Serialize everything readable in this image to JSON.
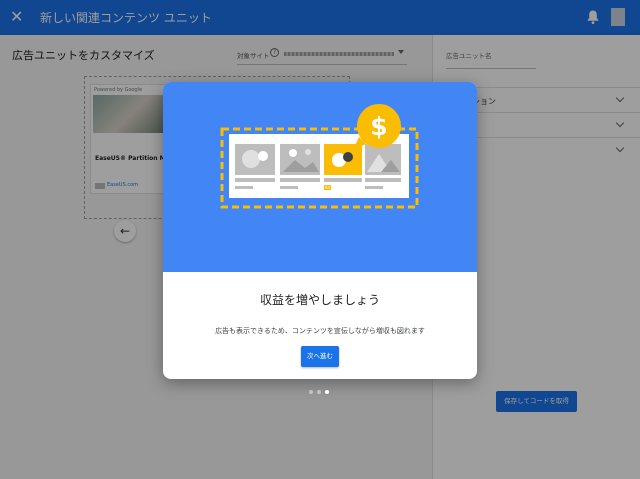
{
  "topbar": {
    "title": "新しい関連コンテンツ ユニット",
    "close_icon": "close-icon",
    "bell_icon": "bell-icon",
    "color": "#1a73e8"
  },
  "editor": {
    "title": "広告ユニットをカスタマイズ",
    "site_label": "対象サイト",
    "help_glyph": "?"
  },
  "preview": {
    "powered_by": "Powered by Google",
    "ad_title": "EaseUS® Partition Ma",
    "ad_source": "EaseUS.com"
  },
  "side_panel": {
    "unit_name_label": "広告ユニット名",
    "sections": [
      {
        "label": "ション"
      },
      {
        "label": ""
      },
      {
        "label": ""
      }
    ],
    "save_label": "保存してコードを取得"
  },
  "dialog": {
    "heading": "収益を増やしましょう",
    "body": "広告も表示できるため、コンテンツを宣伝しながら増収も図れます",
    "next_label": "次へ進む",
    "hero_color": "#4285f4",
    "accent_color": "#fbbc04",
    "ad_badge": "Ad",
    "currency_glyph": "$"
  },
  "pager": {
    "pages": 3,
    "active_index": 2
  }
}
